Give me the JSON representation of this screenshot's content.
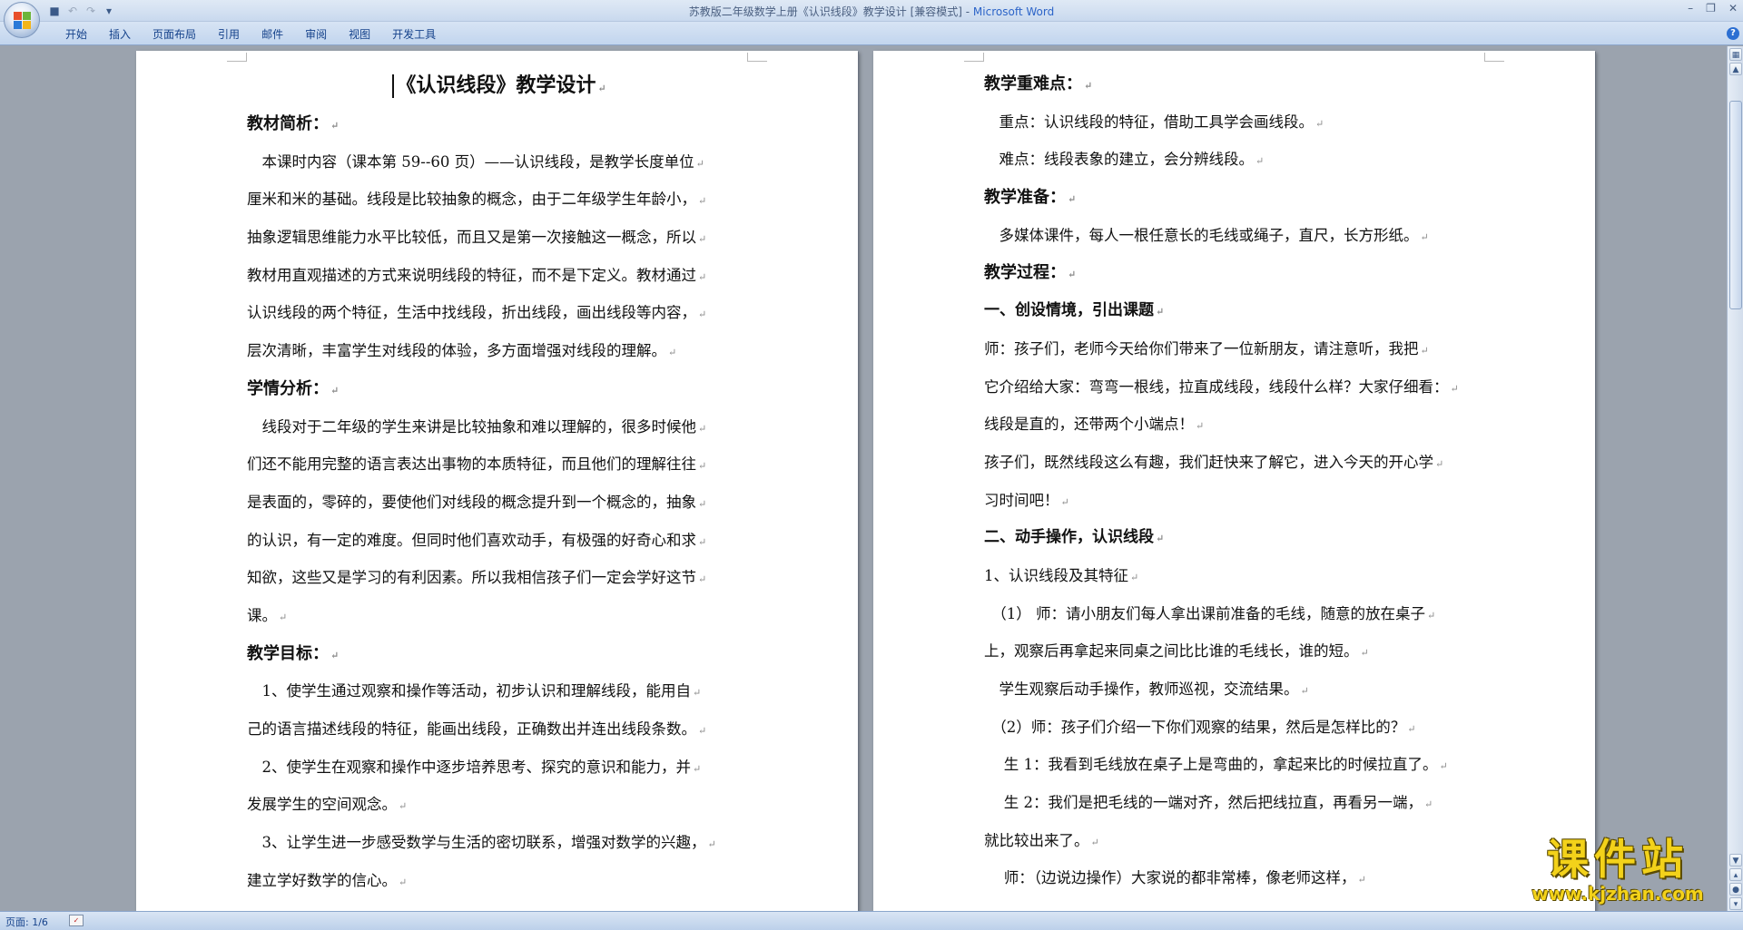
{
  "window": {
    "title": "苏教版二年级数学上册《认识线段》教学设计 [兼容模式] - ",
    "app_name": "Microsoft Word"
  },
  "ribbon": {
    "tabs": [
      "开始",
      "插入",
      "页面布局",
      "引用",
      "邮件",
      "审阅",
      "视图",
      "开发工具"
    ]
  },
  "document": {
    "left_page": [
      {
        "type": "title",
        "text": "《认识线段》教学设计"
      },
      {
        "type": "head",
        "text": "教材简析："
      },
      {
        "type": "body",
        "text": "　本课时内容（课本第 59--60 页）——认识线段，是教学长度单位"
      },
      {
        "type": "body",
        "text": "厘米和米的基础。线段是比较抽象的概念，由于二年级学生年龄小，"
      },
      {
        "type": "body",
        "text": "抽象逻辑思维能力水平比较低，而且又是第一次接触这一概念，所以"
      },
      {
        "type": "body",
        "text": "教材用直观描述的方式来说明线段的特征，而不是下定义。教材通过"
      },
      {
        "type": "body",
        "text": "认识线段的两个特征，生活中找线段，折出线段，画出线段等内容，"
      },
      {
        "type": "body",
        "text": "层次清晰，丰富学生对线段的体验，多方面增强对线段的理解。"
      },
      {
        "type": "head",
        "text": "学情分析："
      },
      {
        "type": "body",
        "text": "　线段对于二年级的学生来讲是比较抽象和难以理解的，很多时候他"
      },
      {
        "type": "body",
        "text": "们还不能用完整的语言表达出事物的本质特征，而且他们的理解往往"
      },
      {
        "type": "body",
        "text": "是表面的，零碎的，要使他们对线段的概念提升到一个概念的，抽象"
      },
      {
        "type": "body",
        "text": "的认识，有一定的难度。但同时他们喜欢动手，有极强的好奇心和求"
      },
      {
        "type": "body",
        "text": "知欲，这些又是学习的有利因素。所以我相信孩子们一定会学好这节"
      },
      {
        "type": "body",
        "text": "课。"
      },
      {
        "type": "head",
        "text": "教学目标："
      },
      {
        "type": "body",
        "text": "　1、使学生通过观察和操作等活动，初步认识和理解线段，能用自"
      },
      {
        "type": "body",
        "text": "己的语言描述线段的特征，能画出线段，正确数出并连出线段条数。"
      },
      {
        "type": "body",
        "text": "　2、使学生在观察和操作中逐步培养思考、探究的意识和能力，并"
      },
      {
        "type": "body",
        "text": "发展学生的空间观念。"
      },
      {
        "type": "body",
        "text": "　3、让学生进一步感受数学与生活的密切联系，增强对数学的兴趣，"
      },
      {
        "type": "body",
        "text": "建立学好数学的信心。"
      }
    ],
    "right_page": [
      {
        "type": "head",
        "text": "教学重难点："
      },
      {
        "type": "body",
        "text": "　重点：认识线段的特征，借助工具学会画线段。"
      },
      {
        "type": "body",
        "text": "　难点：线段表象的建立，会分辨线段。"
      },
      {
        "type": "head",
        "text": "教学准备："
      },
      {
        "type": "body",
        "text": "　多媒体课件，每人一根任意长的毛线或绳子，直尺，长方形纸。"
      },
      {
        "type": "head",
        "text": "教学过程："
      },
      {
        "type": "sub",
        "text": "一、创设情境，引出课题"
      },
      {
        "type": "body",
        "text": " 师：孩子们，老师今天给你们带来了一位新朋友，请注意听，我把"
      },
      {
        "type": "body",
        "text": "它介绍给大家：弯弯一根线，拉直成线段，线段什么样？大家仔细看："
      },
      {
        "type": "body",
        "text": "线段是直的，还带两个小端点！"
      },
      {
        "type": "body",
        "text": "孩子们，既然线段这么有趣，我们赶快来了解它，进入今天的开心学"
      },
      {
        "type": "body",
        "text": "习时间吧！"
      },
      {
        "type": "sub",
        "text": "二、动手操作，认识线段"
      },
      {
        "type": "body",
        "text": "1、认识线段及其特征"
      },
      {
        "type": "body",
        "text": "　（1） 师：请小朋友们每人拿出课前准备的毛线，随意的放在桌子"
      },
      {
        "type": "body",
        "text": "上，观察后再拿起来同桌之间比比谁的毛线长，谁的短。"
      },
      {
        "type": "body",
        "text": "　学生观察后动手操作，教师巡视，交流结果。"
      },
      {
        "type": "body",
        "text": "　（2）师：孩子们介绍一下你们观察的结果，然后是怎样比的？"
      },
      {
        "type": "body",
        "text": "　 生 1：我看到毛线放在桌子上是弯曲的，拿起来比的时候拉直了。"
      },
      {
        "type": "body",
        "text": "　 生 2：我们是把毛线的一端对齐，然后把线拉直，再看另一端，"
      },
      {
        "type": "body",
        "text": "就比较出来了。"
      },
      {
        "type": "body",
        "text": "　 师：（边说边操作）大家说的都非常棒，像老师这样，"
      }
    ]
  },
  "status": {
    "pages": "页面: 1/6"
  },
  "watermark": {
    "title": "课件站",
    "url": "www.kjzhan.com"
  }
}
